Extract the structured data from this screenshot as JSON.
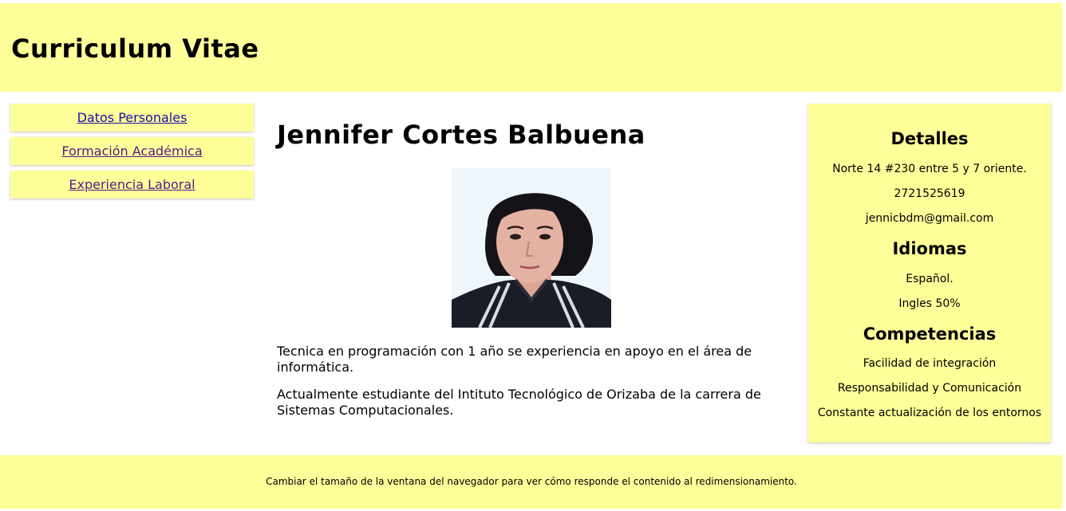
{
  "header": {
    "title": "Curriculum Vitae"
  },
  "nav": {
    "items": [
      {
        "label": "Datos Personales"
      },
      {
        "label": "Formación Académica"
      },
      {
        "label": "Experiencia Laboral"
      }
    ]
  },
  "main": {
    "name": "Jennifer Cortes Balbuena",
    "paragraphs": [
      "Tecnica en programación con 1 año se experiencia en apoyo en el área de informática.",
      "Actualmente estudiante del Intituto Tecnológico de Orizaba de la carrera de Sistemas Computacionales."
    ]
  },
  "aside": {
    "details_title": "Detalles",
    "address": "Norte 14 #230 entre 5 y 7 oriente.",
    "phone": "2721525619",
    "email": "jennicbdm@gmail.com",
    "languages_title": "Idiomas",
    "languages": [
      "Español.",
      "Ingles 50%"
    ],
    "skills_title": "Competencias",
    "skills": [
      "Facilidad de integración",
      "Responsabilidad y Comunicación",
      "Constante actualización de los entornos"
    ]
  },
  "footer": {
    "text": "Cambiar el tamaño de la ventana del navegador para ver cómo responde el contenido al redimensionamiento."
  },
  "colors": {
    "panel_background": "#ffff99",
    "link_unvisited": "#1a0dab",
    "link_visited": "#551a8b"
  }
}
